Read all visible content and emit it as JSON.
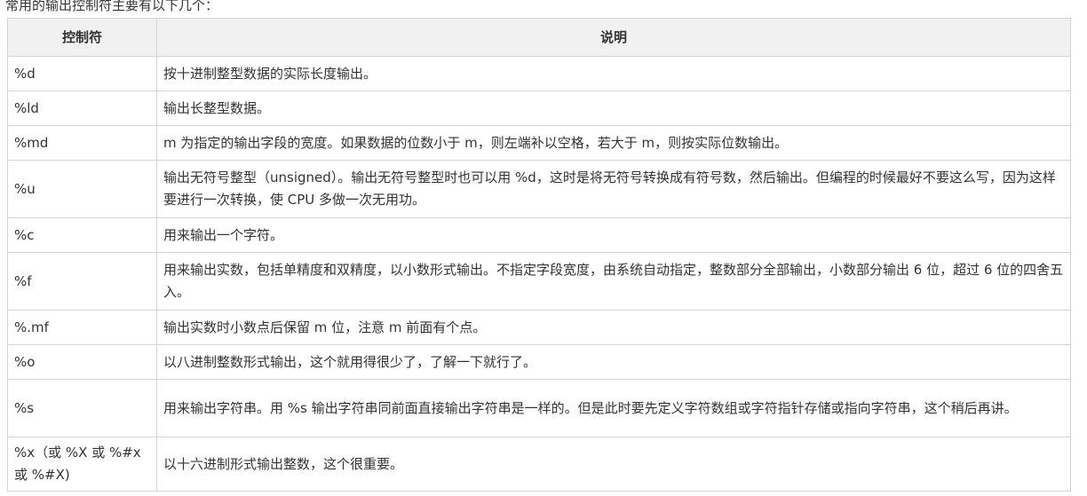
{
  "intro_text": "常用的输出控制符主要有以下几个：",
  "table": {
    "headers": [
      "控制符",
      "说明"
    ],
    "rows": [
      {
        "code": "%d",
        "desc": "按十进制整型数据的实际长度输出。"
      },
      {
        "code": "%ld",
        "desc": "输出长整型数据。"
      },
      {
        "code": "%md",
        "desc": "m 为指定的输出字段的宽度。如果数据的位数小于 m，则左端补以空格，若大于 m，则按实际位数输出。"
      },
      {
        "code": "%u",
        "desc": "输出无符号整型（unsigned）。输出无符号整型时也可以用 %d，这时是将无符号转换成有符号数，然后输出。但编程的时候最好不要这么写，因为这样要进行一次转换，使 CPU 多做一次无用功。"
      },
      {
        "code": "%c",
        "desc": "用来输出一个字符。"
      },
      {
        "code": "%f",
        "desc": "用来输出实数，包括单精度和双精度，以小数形式输出。不指定字段宽度，由系统自动指定，整数部分全部输出，小数部分输出 6 位，超过 6 位的四舍五入。"
      },
      {
        "code": "%.mf",
        "desc": "输出实数时小数点后保留 m 位，注意 m 前面有个点。"
      },
      {
        "code": "%o",
        "desc": "以八进制整数形式输出，这个就用得很少了，了解一下就行了。"
      },
      {
        "code": "%s",
        "desc": "用来输出字符串。用 %s 输出字符串同前面直接输出字符串是一样的。但是此时要先定义字符数组或字符指针存储或指向字符串，这个稍后再讲。"
      },
      {
        "code": "%x（或 %X 或 %#x 或 %#X)",
        "desc": "以十六进制形式输出整数，这个很重要。"
      }
    ]
  }
}
